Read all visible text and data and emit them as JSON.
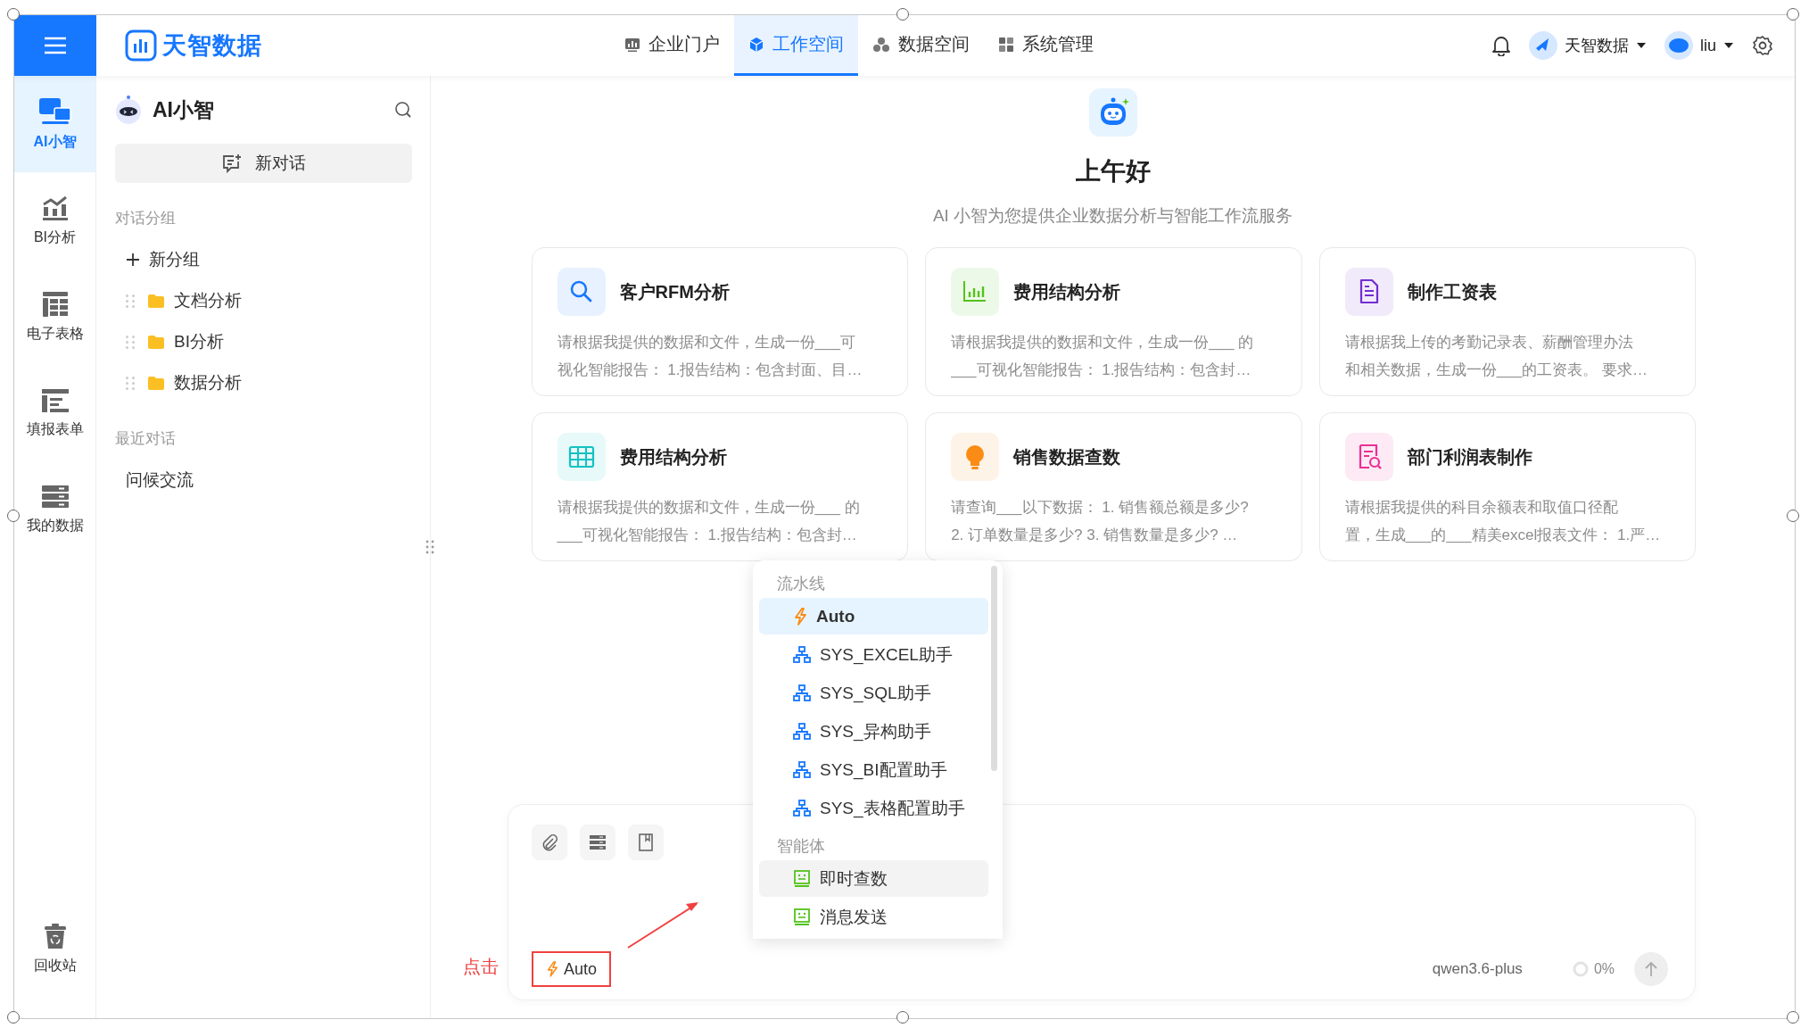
{
  "top_bar": {
    "logo": "天智数据",
    "tabs": [
      {
        "label": "企业门户",
        "selected": false,
        "kind": "dashboard"
      },
      {
        "label": "工作空间",
        "selected": true,
        "kind": "cube"
      },
      {
        "label": "数据空间",
        "selected": false,
        "kind": "cluster"
      },
      {
        "label": "系统管理",
        "selected": false,
        "kind": "grid"
      }
    ],
    "org": "天智数据",
    "user": "liu"
  },
  "rail": {
    "items": [
      {
        "label": "AI小智",
        "selected": true,
        "kind": "ai"
      },
      {
        "label": "BI分析",
        "selected": false,
        "kind": "chart"
      },
      {
        "label": "电子表格",
        "selected": false,
        "kind": "sheet"
      },
      {
        "label": "填报表单",
        "selected": false,
        "kind": "form"
      },
      {
        "label": "我的数据",
        "selected": false,
        "kind": "data"
      }
    ],
    "bottom": {
      "label": "回收站"
    }
  },
  "sidebar": {
    "title": "AI小智",
    "new_chat": "新对话",
    "group_heading": "对话分组",
    "new_group": "新分组",
    "groups": [
      "文档分析",
      "BI分析",
      "数据分析"
    ],
    "recent_heading": "最近对话",
    "recent": [
      "问候交流"
    ]
  },
  "main": {
    "greeting": "上午好",
    "subtitle": "AI 小智为您提供企业数据分析与智能工作流服务",
    "cards": [
      {
        "title": "客户RFM分析",
        "kind": "search",
        "color": "#1677ff",
        "lines": [
          "请根据我提供的数据和文件，生成一份___可",
          "视化智能报告： 1.报告结构：包含封面、目…"
        ]
      },
      {
        "title": "费用结构分析",
        "kind": "bars",
        "color": "#52c41a",
        "lines": [
          "请根据我提供的数据和文件，生成一份___ 的",
          "___可视化智能报告： 1.报告结构：包含封…"
        ]
      },
      {
        "title": "制作工资表",
        "kind": "document",
        "color": "#722ed1",
        "lines": [
          "请根据我上传的考勤记录表、薪酬管理办法",
          "和相关数据，生成一份___的工资表。 要求…"
        ]
      },
      {
        "title": "费用结构分析",
        "kind": "table",
        "color": "#13c2c2",
        "lines": [
          "请根据我提供的数据和文件，生成一份___ 的",
          "___可视化智能报告： 1.报告结构：包含封…"
        ]
      },
      {
        "title": "销售数据查数",
        "kind": "bulb",
        "color": "#fa8c16",
        "lines": [
          "请查询___以下数据： 1. 销售额总额是多少?",
          "2. 订单数量是多少? 3. 销售数量是多少? …"
        ]
      },
      {
        "title": "部门利润表制作",
        "kind": "report",
        "color": "#eb2f96",
        "lines": [
          "请根据我提供的科目余额表和取值口径配",
          "置，生成___的___精美excel报表文件： 1.严…"
        ]
      }
    ]
  },
  "dropdown": {
    "sections": [
      {
        "heading": "流水线",
        "items": [
          {
            "label": "Auto",
            "kind": "auto",
            "selected": true,
            "hovered": false
          },
          {
            "label": "SYS_EXCEL助手",
            "kind": "flow",
            "selected": false,
            "hovered": false
          },
          {
            "label": "SYS_SQL助手",
            "kind": "flow",
            "selected": false,
            "hovered": false
          },
          {
            "label": "SYS_异构助手",
            "kind": "flow",
            "selected": false,
            "hovered": false
          },
          {
            "label": "SYS_BI配置助手",
            "kind": "flow",
            "selected": false,
            "hovered": false
          },
          {
            "label": "SYS_表格配置助手",
            "kind": "flow",
            "selected": false,
            "hovered": false
          }
        ]
      },
      {
        "heading": "智能体",
        "items": [
          {
            "label": "即时查数",
            "kind": "agent",
            "selected": false,
            "hovered": true
          },
          {
            "label": "消息发送",
            "kind": "agent",
            "selected": false,
            "hovered": false
          }
        ]
      }
    ]
  },
  "composer": {
    "mode": "Auto",
    "model": "qwen3.6-plus",
    "usage": "0%"
  },
  "annotation": {
    "label": "点击"
  }
}
